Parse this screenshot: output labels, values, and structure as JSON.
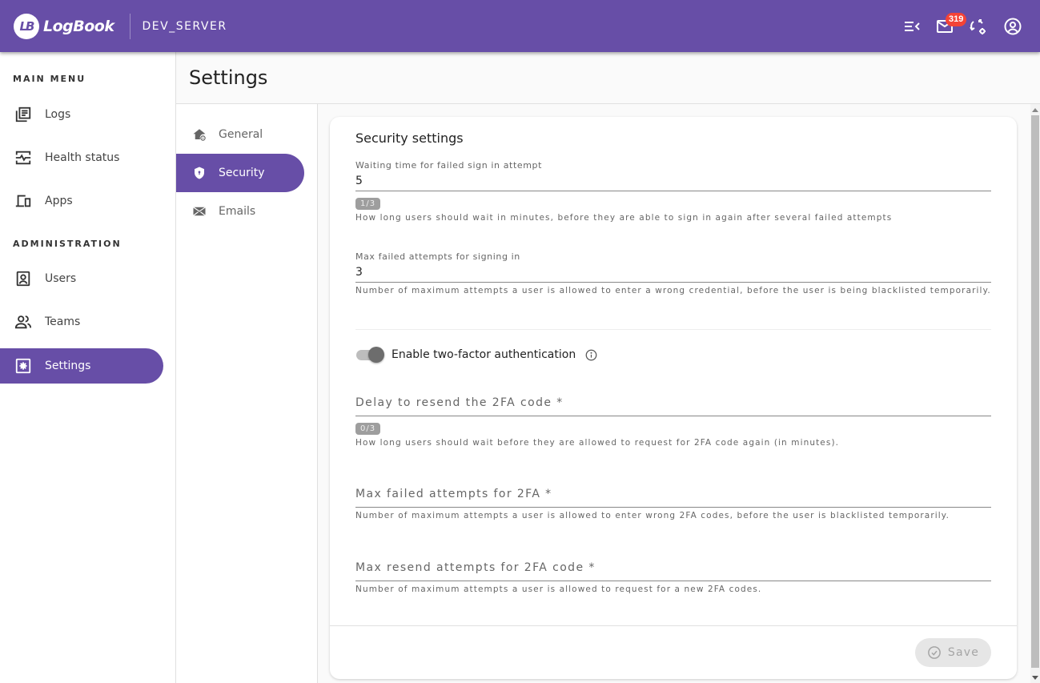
{
  "app": {
    "logo_mark": "LB",
    "logo_text": "LogBook",
    "server_name": "DEV_SERVER"
  },
  "topbar": {
    "icons": [
      "menu-collapse-icon",
      "mail-icon",
      "sync-settings-icon",
      "account-icon"
    ],
    "mail_badge": "319"
  },
  "colors": {
    "brand": "#674ea7",
    "badge": "#f44336"
  },
  "sidebar": {
    "main_menu_label": "MAIN MENU",
    "main_items": [
      {
        "label": "Logs",
        "icon": "logs-icon"
      },
      {
        "label": "Health status",
        "icon": "health-status-icon"
      },
      {
        "label": "Apps",
        "icon": "apps-icon"
      }
    ],
    "admin_label": "ADMINISTRATION",
    "admin_items": [
      {
        "label": "Users",
        "icon": "users-icon"
      },
      {
        "label": "Teams",
        "icon": "teams-icon"
      },
      {
        "label": "Settings",
        "icon": "settings-icon",
        "active": true
      }
    ]
  },
  "page": {
    "title": "Settings"
  },
  "settings_nav": [
    {
      "label": "General",
      "icon": "home-gear-icon"
    },
    {
      "label": "Security",
      "icon": "shield-icon",
      "active": true
    },
    {
      "label": "Emails",
      "icon": "envelope-icon"
    }
  ],
  "security": {
    "title": "Security settings",
    "waiting_time": {
      "label": "Waiting time for failed sign in attempt",
      "value": "5",
      "counter": "1/3",
      "hint": "How long users should wait in minutes, before they are able to sign in again after several failed attempts"
    },
    "max_failed_signin": {
      "label": "Max failed attempts for signing in",
      "value": "3",
      "hint": "Number of maximum attempts a user is allowed to enter a wrong credential, before the user is being blacklisted temporarily."
    },
    "two_factor": {
      "label": "Enable two-factor authentication",
      "enabled": true
    },
    "resend_delay": {
      "label": "Delay to resend the 2FA code *",
      "value": "",
      "counter": "0/3",
      "hint": "How long users should wait before they are allowed to request for 2FA code again (in minutes)."
    },
    "max_failed_2fa": {
      "label": "Max failed attempts for 2FA *",
      "value": "",
      "hint": "Number of maximum attempts a user is allowed to enter wrong 2FA codes, before the user is blacklisted temporarily."
    },
    "max_resend_2fa": {
      "label": "Max resend attempts for 2FA code *",
      "value": "",
      "hint": "Number of maximum attempts a user is allowed to request for a new 2FA codes."
    },
    "save_label": "Save"
  }
}
